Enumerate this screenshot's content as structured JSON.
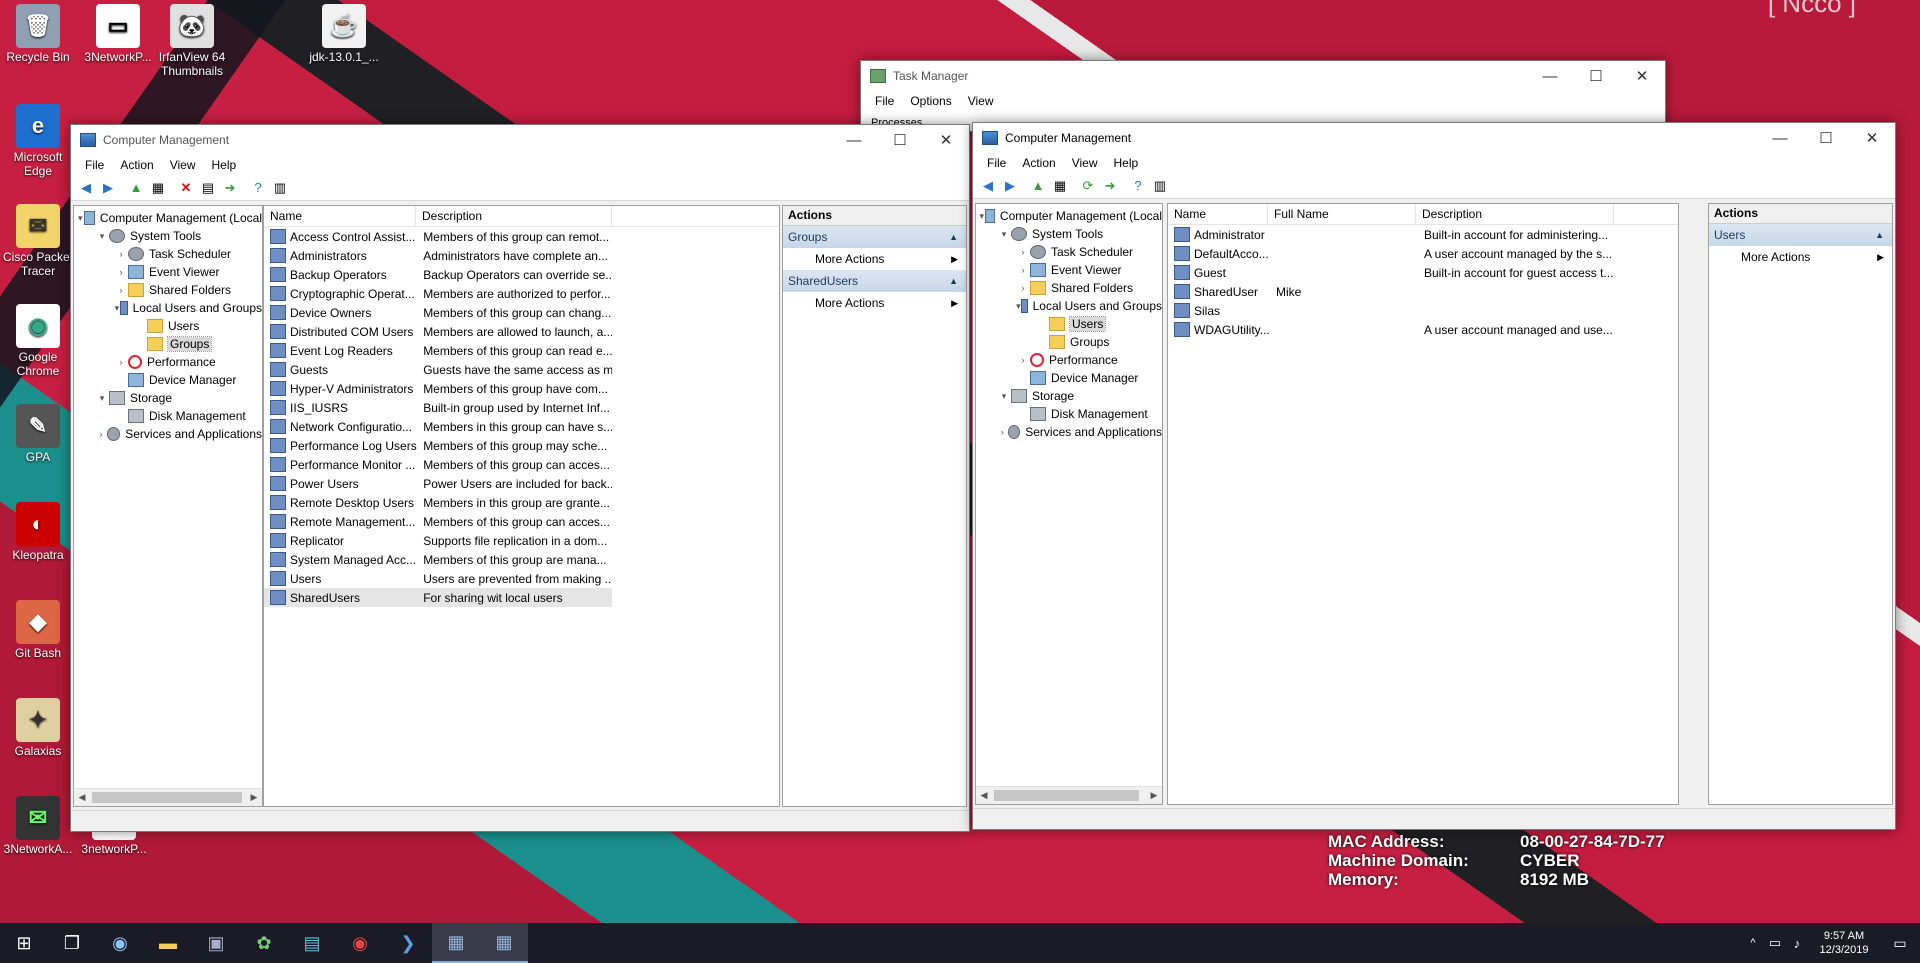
{
  "desktop": {
    "icons": [
      {
        "label": "Recycle Bin",
        "glyph": "🗑"
      },
      {
        "label": "3NetworkP...",
        "glyph": "▭"
      },
      {
        "label": "IrfanView 64 Thumbnails",
        "glyph": "🐼"
      },
      {
        "label": "jdk-13.0.1_...",
        "glyph": "☕"
      },
      {
        "label": "Microsoft Edge",
        "glyph": "e"
      },
      {
        "label": "Cisco Packet Tracer",
        "glyph": "✉"
      },
      {
        "label": "Google Chrome",
        "glyph": "◉"
      },
      {
        "label": "GPA",
        "glyph": "✎"
      },
      {
        "label": "Kleopatra",
        "glyph": "◐"
      },
      {
        "label": "Git Bash",
        "glyph": "◆"
      },
      {
        "label": "Galaxias",
        "glyph": "✦"
      },
      {
        "label": "3NetworkA...",
        "glyph": "✉"
      },
      {
        "label": "3networkP...",
        "glyph": "▭"
      }
    ],
    "sysinfo": [
      {
        "key": "MAC Address:",
        "value": "08-00-27-84-7D-77"
      },
      {
        "key": "Machine Domain:",
        "value": "CYBER"
      },
      {
        "key": "Memory:",
        "value": "8192 MB"
      }
    ]
  },
  "task_manager": {
    "title": "Task Manager",
    "menu": [
      "File",
      "Options",
      "View"
    ],
    "tab_first": "Processes"
  },
  "cm_left": {
    "title": "Computer Management",
    "menu": [
      "File",
      "Action",
      "View",
      "Help"
    ],
    "tree": [
      {
        "label": "Computer Management (Local",
        "level": 0,
        "exp": "▾",
        "icon": "comp"
      },
      {
        "label": "System Tools",
        "level": 1,
        "exp": "▾",
        "icon": "gear"
      },
      {
        "label": "Task Scheduler",
        "level": 2,
        "exp": "›",
        "icon": "gear"
      },
      {
        "label": "Event Viewer",
        "level": 2,
        "exp": "›",
        "icon": "comp"
      },
      {
        "label": "Shared Folders",
        "level": 2,
        "exp": "›",
        "icon": "folder"
      },
      {
        "label": "Local Users and Groups",
        "level": 2,
        "exp": "▾",
        "icon": "users"
      },
      {
        "label": "Users",
        "level": 3,
        "exp": "",
        "icon": "folder"
      },
      {
        "label": "Groups",
        "level": 3,
        "exp": "",
        "icon": "folder",
        "selected": true
      },
      {
        "label": "Performance",
        "level": 2,
        "exp": "›",
        "icon": "perf"
      },
      {
        "label": "Device Manager",
        "level": 2,
        "exp": "",
        "icon": "comp"
      },
      {
        "label": "Storage",
        "level": 1,
        "exp": "▾",
        "icon": "disk"
      },
      {
        "label": "Disk Management",
        "level": 2,
        "exp": "",
        "icon": "disk"
      },
      {
        "label": "Services and Applications",
        "level": 1,
        "exp": "›",
        "icon": "gear"
      }
    ],
    "columns": [
      "Name",
      "Description"
    ],
    "rows": [
      {
        "name": "Access Control Assist...",
        "desc": "Members of this group can remot..."
      },
      {
        "name": "Administrators",
        "desc": "Administrators have complete an..."
      },
      {
        "name": "Backup Operators",
        "desc": "Backup Operators can override se..."
      },
      {
        "name": "Cryptographic Operat...",
        "desc": "Members are authorized to perfor..."
      },
      {
        "name": "Device Owners",
        "desc": "Members of this group can chang..."
      },
      {
        "name": "Distributed COM Users",
        "desc": "Members are allowed to launch, a..."
      },
      {
        "name": "Event Log Readers",
        "desc": "Members of this group can read e..."
      },
      {
        "name": "Guests",
        "desc": "Guests have the same access as m..."
      },
      {
        "name": "Hyper-V Administrators",
        "desc": "Members of this group have com..."
      },
      {
        "name": "IIS_IUSRS",
        "desc": "Built-in group used by Internet Inf..."
      },
      {
        "name": "Network Configuratio...",
        "desc": "Members in this group can have s..."
      },
      {
        "name": "Performance Log Users",
        "desc": "Members of this group may sche..."
      },
      {
        "name": "Performance Monitor ...",
        "desc": "Members of this group can acces..."
      },
      {
        "name": "Power Users",
        "desc": "Power Users are included for back..."
      },
      {
        "name": "Remote Desktop Users",
        "desc": "Members in this group are grante..."
      },
      {
        "name": "Remote Management...",
        "desc": "Members of this group can acces..."
      },
      {
        "name": "Replicator",
        "desc": "Supports file replication in a dom..."
      },
      {
        "name": "System Managed Acc...",
        "desc": "Members of this group are mana..."
      },
      {
        "name": "Users",
        "desc": "Users are prevented from making ..."
      },
      {
        "name": "SharedUsers",
        "desc": "For sharing wit local users",
        "selected": true
      }
    ],
    "actions": {
      "title": "Actions",
      "sections": [
        {
          "label": "Groups",
          "item": "More Actions"
        },
        {
          "label": "SharedUsers",
          "item": "More Actions"
        }
      ]
    }
  },
  "cm_right": {
    "title": "Computer Management",
    "menu": [
      "File",
      "Action",
      "View",
      "Help"
    ],
    "tree": [
      {
        "label": "Computer Management (Local",
        "level": 0,
        "exp": "▾",
        "icon": "comp"
      },
      {
        "label": "System Tools",
        "level": 1,
        "exp": "▾",
        "icon": "gear"
      },
      {
        "label": "Task Scheduler",
        "level": 2,
        "exp": "›",
        "icon": "gear"
      },
      {
        "label": "Event Viewer",
        "level": 2,
        "exp": "›",
        "icon": "comp"
      },
      {
        "label": "Shared Folders",
        "level": 2,
        "exp": "›",
        "icon": "folder"
      },
      {
        "label": "Local Users and Groups",
        "level": 2,
        "exp": "▾",
        "icon": "users"
      },
      {
        "label": "Users",
        "level": 3,
        "exp": "",
        "icon": "folder",
        "selected": true
      },
      {
        "label": "Groups",
        "level": 3,
        "exp": "",
        "icon": "folder"
      },
      {
        "label": "Performance",
        "level": 2,
        "exp": "›",
        "icon": "perf"
      },
      {
        "label": "Device Manager",
        "level": 2,
        "exp": "",
        "icon": "comp"
      },
      {
        "label": "Storage",
        "level": 1,
        "exp": "▾",
        "icon": "disk"
      },
      {
        "label": "Disk Management",
        "level": 2,
        "exp": "",
        "icon": "disk"
      },
      {
        "label": "Services and Applications",
        "level": 1,
        "exp": "›",
        "icon": "gear"
      }
    ],
    "columns": [
      "Name",
      "Full Name",
      "Description"
    ],
    "rows": [
      {
        "name": "Administrator",
        "full": "",
        "desc": "Built-in account for administering..."
      },
      {
        "name": "DefaultAcco...",
        "full": "",
        "desc": "A user account managed by the s..."
      },
      {
        "name": "Guest",
        "full": "",
        "desc": "Built-in account for guest access t..."
      },
      {
        "name": "SharedUser",
        "full": "Mike",
        "desc": ""
      },
      {
        "name": "Silas",
        "full": "",
        "desc": ""
      },
      {
        "name": "WDAGUtility...",
        "full": "",
        "desc": "A user account managed and use..."
      }
    ],
    "actions": {
      "title": "Actions",
      "sections": [
        {
          "label": "Users",
          "item": "More Actions"
        }
      ]
    }
  },
  "taskbar": {
    "clock_time": "9:57 AM",
    "clock_date": "12/3/2019"
  }
}
